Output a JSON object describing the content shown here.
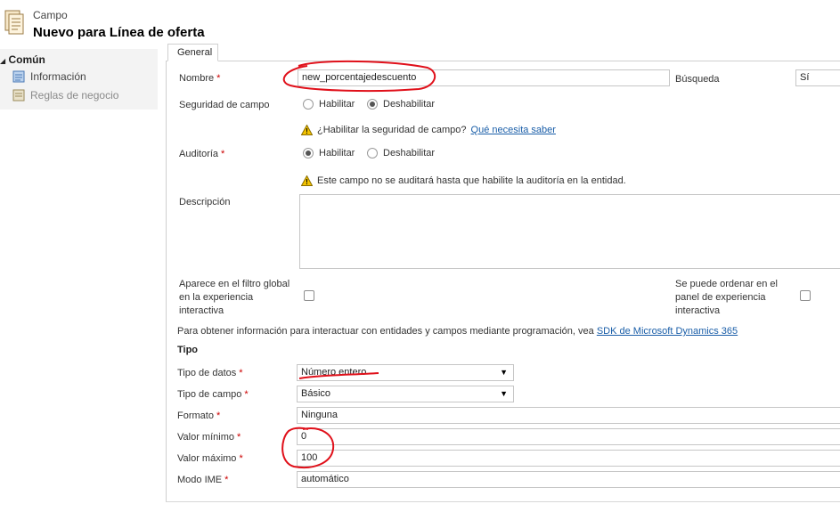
{
  "header": {
    "entity_label": "Campo",
    "title": "Nuevo para Línea de oferta"
  },
  "sidebar": {
    "group_label": "Común",
    "items": [
      {
        "label": "Información",
        "icon": "info-icon"
      },
      {
        "label": "Reglas de negocio",
        "icon": "rules-icon"
      }
    ]
  },
  "tabs": [
    {
      "label": "General"
    }
  ],
  "form": {
    "nombre_label": "Nombre",
    "nombre_value": "new_porcentajedescuento",
    "busqueda_label": "Búsqueda",
    "busqueda_value": "Sí",
    "seguridad_label": "Seguridad de campo",
    "seguridad_opt1": "Habilitar",
    "seguridad_opt2": "Deshabilitar",
    "seguridad_selected": "Deshabilitar",
    "seguridad_warning": "¿Habilitar la seguridad de campo?",
    "seguridad_link": "Qué necesita saber",
    "auditoria_label": "Auditoría",
    "auditoria_opt1": "Habilitar",
    "auditoria_opt2": "Deshabilitar",
    "auditoria_selected": "Habilitar",
    "auditoria_warning": "Este campo no se auditará hasta que habilite la auditoría en la entidad.",
    "descripcion_label": "Descripción",
    "filtro_label": "Aparece en el filtro global en la experiencia interactiva",
    "ordenar_label": "Se puede ordenar en el panel de experiencia interactiva",
    "sdk_text": "Para obtener información para interactuar con entidades y campos mediante programación, vea",
    "sdk_link": "SDK de Microsoft Dynamics 365",
    "tipo_section": "Tipo",
    "tipo_datos_label": "Tipo de datos",
    "tipo_datos_value": "Número entero",
    "tipo_campo_label": "Tipo de campo",
    "tipo_campo_value": "Básico",
    "formato_label": "Formato",
    "formato_value": "Ninguna",
    "valor_min_label": "Valor mínimo",
    "valor_min_value": "0",
    "valor_max_label": "Valor máximo",
    "valor_max_value": "100",
    "modo_ime_label": "Modo IME",
    "modo_ime_value": "automático",
    "required_mark": "*"
  },
  "colors": {
    "accent_link": "#1a5ea8",
    "required": "#cc0000",
    "annotation": "#e0101a"
  }
}
